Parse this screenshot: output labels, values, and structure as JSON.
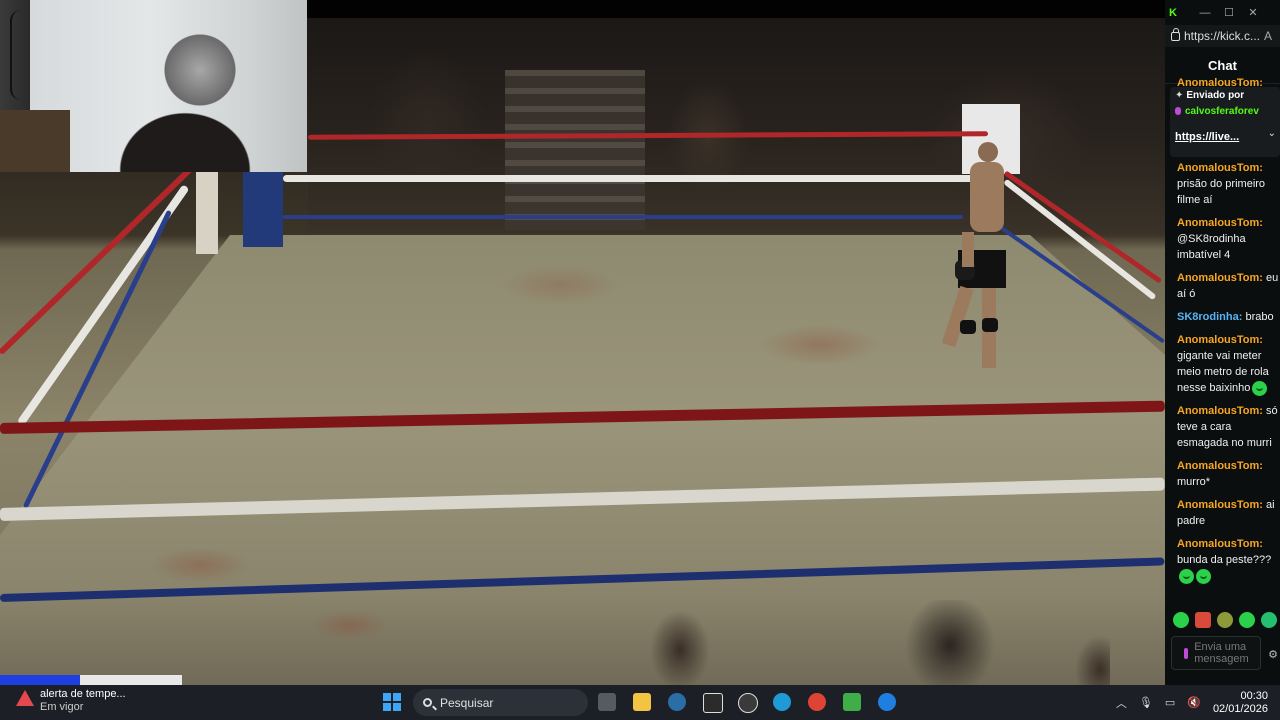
{
  "chat_window": {
    "url": "https://kick.c...",
    "url_suffix": "A",
    "title": "Chat",
    "top_partial_user": "AnomalousTom:",
    "pinned": {
      "label": "Enviado por",
      "user": "calvosferaforev",
      "link": "https://live..."
    },
    "messages": [
      {
        "user": "AnomalousTom:",
        "text": "prisão do primeiro filme aí"
      },
      {
        "user": "AnomalousTom:",
        "text": "@SK8rodinha imbatível 4"
      },
      {
        "user": "AnomalousTom:",
        "text": "eu aí ó"
      },
      {
        "user": "SK8rodinha:",
        "text": "brabo"
      },
      {
        "user": "AnomalousTom:",
        "text": "gigante vai meter meio metro de rola nesse baixinho"
      },
      {
        "user": "AnomalousTom:",
        "text": "só teve a cara esmagada no murri"
      },
      {
        "user": "AnomalousTom:",
        "text": "murro*"
      },
      {
        "user": "AnomalousTom:",
        "text": "ai padre"
      },
      {
        "user": "AnomalousTom:",
        "text": "bunda da peste???"
      }
    ],
    "input_placeholder": "Envia uma mensagem"
  },
  "taskbar": {
    "weather_title": "alerta de tempe...",
    "weather_sub": "Em vigor",
    "search_placeholder": "Pesquisar",
    "time": "00:30",
    "date": "02/01/2026"
  },
  "colors": {
    "kick_green": "#53fc18",
    "username_orange": "#f6a623",
    "username_blue": "#56b4f5",
    "chat_bg": "#0b0e0f",
    "taskbar_bg": "#1c1f26"
  }
}
